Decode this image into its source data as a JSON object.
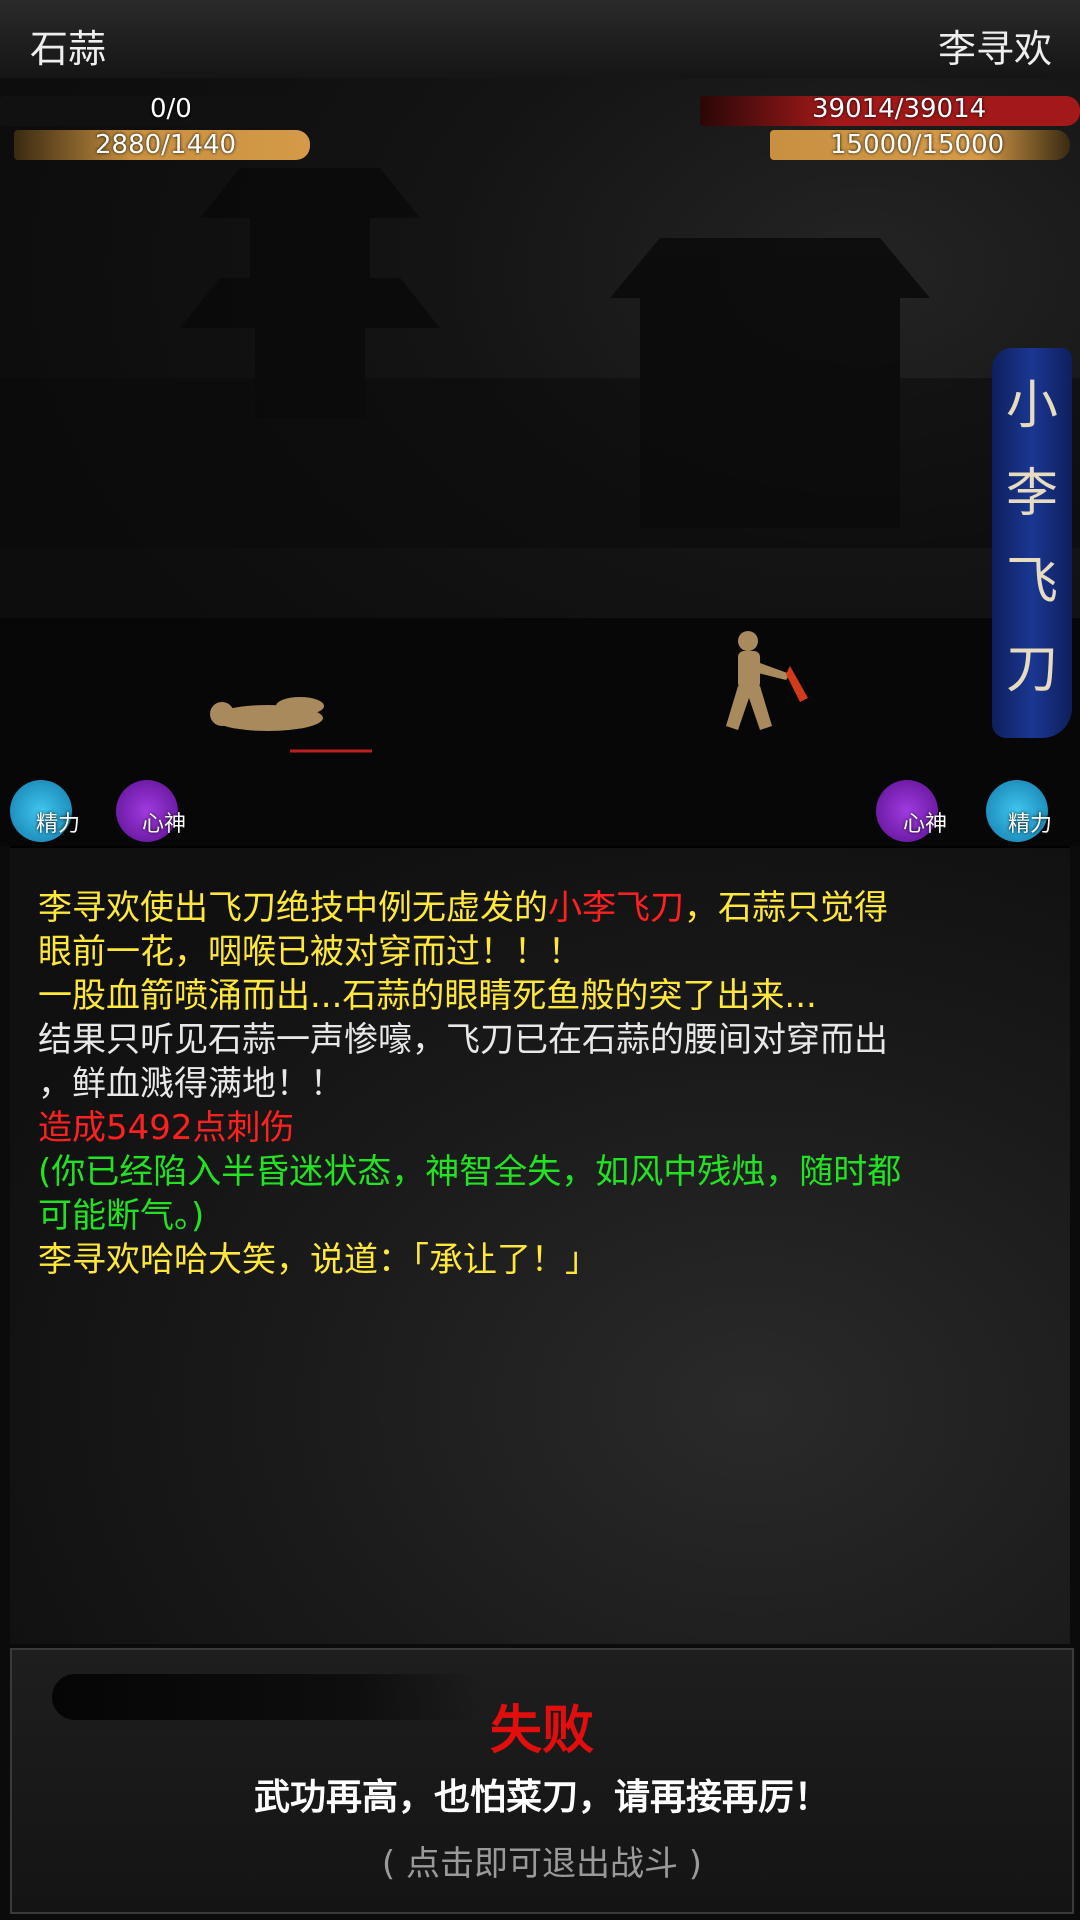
{
  "header": {
    "player_name": "石蒜",
    "enemy_name": "李寻欢"
  },
  "player_stats": {
    "hp": "0/0",
    "energy": "2880/1440"
  },
  "enemy_stats": {
    "hp": "39014/39014",
    "energy": "15000/15000"
  },
  "skill_banner": {
    "chars": [
      "小",
      "李",
      "飞",
      "刀"
    ]
  },
  "status": {
    "left": [
      {
        "label": "精力",
        "color": "#1fa6d6"
      },
      {
        "label": "心神",
        "color": "#7a1fc0"
      }
    ],
    "right": [
      {
        "label": "心神",
        "color": "#7a1fc0"
      },
      {
        "label": "精力",
        "color": "#1fa6d6"
      }
    ]
  },
  "battle_log": {
    "line1_a": "李寻欢使出飞刀绝技中例无虚发的",
    "line1_b": "小李飞刀",
    "line1_c": "，石蒜只觉得",
    "line2": "眼前一花，咽喉已被对穿而过！！！",
    "line3": "一股血箭喷涌而出...石蒜的眼睛死鱼般的突了出来...",
    "line4": "结果只听见石蒜一声惨嚎，飞刀已在石蒜的腰间对穿而出",
    "line5": "，鲜血溅得满地！！",
    "line6": "造成5492点刺伤",
    "line7": "(你已经陷入半昏迷状态，神智全失，如风中残烛，随时都",
    "line8": "可能断气。)",
    "line9": "李寻欢哈哈大笑，说道：「承让了！」"
  },
  "result": {
    "title": "失败",
    "message": "武功再高，也怕菜刀，请再接再厉！",
    "hint": "( 点击即可退出战斗 )"
  },
  "colors": {
    "hp_bar": "#a31919",
    "energy_bar": "#c89040",
    "defeat": "#e20d0d"
  }
}
